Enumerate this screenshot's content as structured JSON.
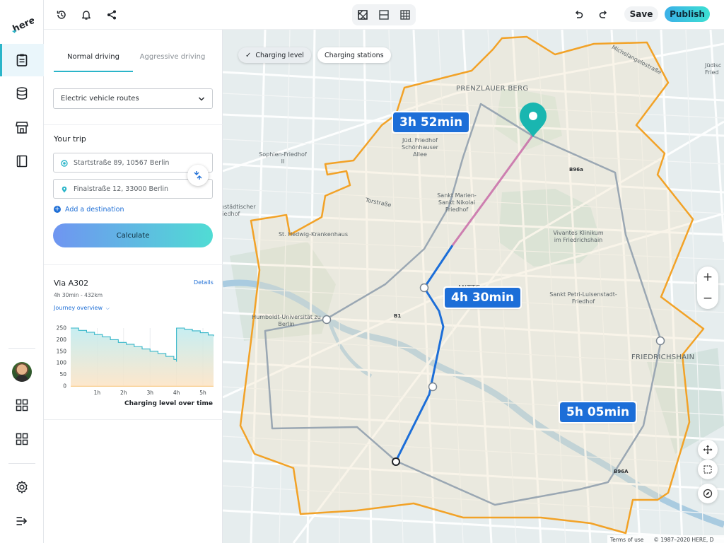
{
  "app": {
    "logo_text": "here"
  },
  "rail": {
    "items": [
      {
        "name": "clipboard-icon",
        "active": true
      },
      {
        "name": "database-icon",
        "active": false
      },
      {
        "name": "store-icon",
        "active": false
      },
      {
        "name": "book-icon",
        "active": false
      }
    ],
    "bottom_items": [
      "grid-icon",
      "grid-icon",
      "gear-icon",
      "collapse-icon"
    ]
  },
  "topbar": {
    "left_icons": [
      "history-icon",
      "bell-icon",
      "share-icon"
    ],
    "view_modes": [
      "map-view-icon",
      "split-view-icon",
      "table-view-icon"
    ],
    "save_label": "Save",
    "publish_label": "Publish"
  },
  "panel": {
    "tabs": [
      {
        "label": "Normal driving",
        "active": true
      },
      {
        "label": "Aggressive driving",
        "active": false
      }
    ],
    "route_type": "Electric vehicle routes",
    "trip_title": "Your trip",
    "origin": "Startstraße 89, 10567 Berlin",
    "destination": "Finalstraße 12, 33000 Berlin",
    "add_destination": "Add a destination",
    "calculate_label": "Calculate",
    "via": {
      "title": "Via A302",
      "details_label": "Details",
      "meta": "4h 30min - 432km",
      "journey_label": "Journey overview"
    }
  },
  "chart_data": {
    "type": "area",
    "title": "Charging level over time",
    "x_ticks": [
      "1h",
      "2h",
      "3h",
      "4h",
      "5h"
    ],
    "y_ticks": [
      0,
      50,
      100,
      150,
      200,
      250
    ],
    "ylim": [
      0,
      250
    ],
    "xlim": [
      0,
      5.4
    ],
    "series": [
      {
        "x": [
          0,
          0.3,
          0.6,
          0.9,
          1.2,
          1.5,
          1.8,
          2.1,
          2.4,
          2.7,
          3.0,
          3.3,
          3.6,
          3.9,
          4.0,
          4.0,
          4.3,
          4.6,
          4.9,
          5.2,
          5.4
        ],
        "values": [
          250,
          240,
          232,
          222,
          212,
          200,
          188,
          180,
          170,
          160,
          150,
          140,
          128,
          115,
          105,
          250,
          245,
          238,
          230,
          220,
          215
        ]
      }
    ],
    "colors": {
      "line": "#33b5c8",
      "fill_top": "#bdebf0",
      "fill_bottom": "#fde3c3"
    }
  },
  "map": {
    "toggles": [
      {
        "label": "Charging level",
        "active": true
      },
      {
        "label": "Charging stations",
        "active": false
      }
    ],
    "time_labels": [
      "3h 52min",
      "4h 30min",
      "5h 05min"
    ],
    "districts": [
      "PRENZLAUER BERG",
      "MITTE",
      "FRIEDRICHSHAIN"
    ],
    "places": [
      "Jüd. Friedhof Schönhauser Allee",
      "Sophien-Friedhof II",
      "Sankt Marien-Sankt Nikolai Friedhof",
      "St. Hedwig-Krankenhaus",
      "Vivantes Klinikum im Friedrichshain",
      "Sankt Petri-Luisenstadt-Friedhof",
      "Humboldt-Universität zu Berlin",
      "Torstraße",
      "Michelangelostraße",
      "enstädtischer Friedhof",
      "Jüdisc Fried",
      "B1",
      "B96a",
      "B96A"
    ],
    "attribution": [
      "Terms of use",
      "© 1987–2020 HERE, D"
    ],
    "colors": {
      "isoline": "#f2a227",
      "route_main": "#1c6ed8",
      "route_alt": "#9aa7b3",
      "route_segment": "#c35ba0",
      "pin": "#19b6b0"
    }
  }
}
